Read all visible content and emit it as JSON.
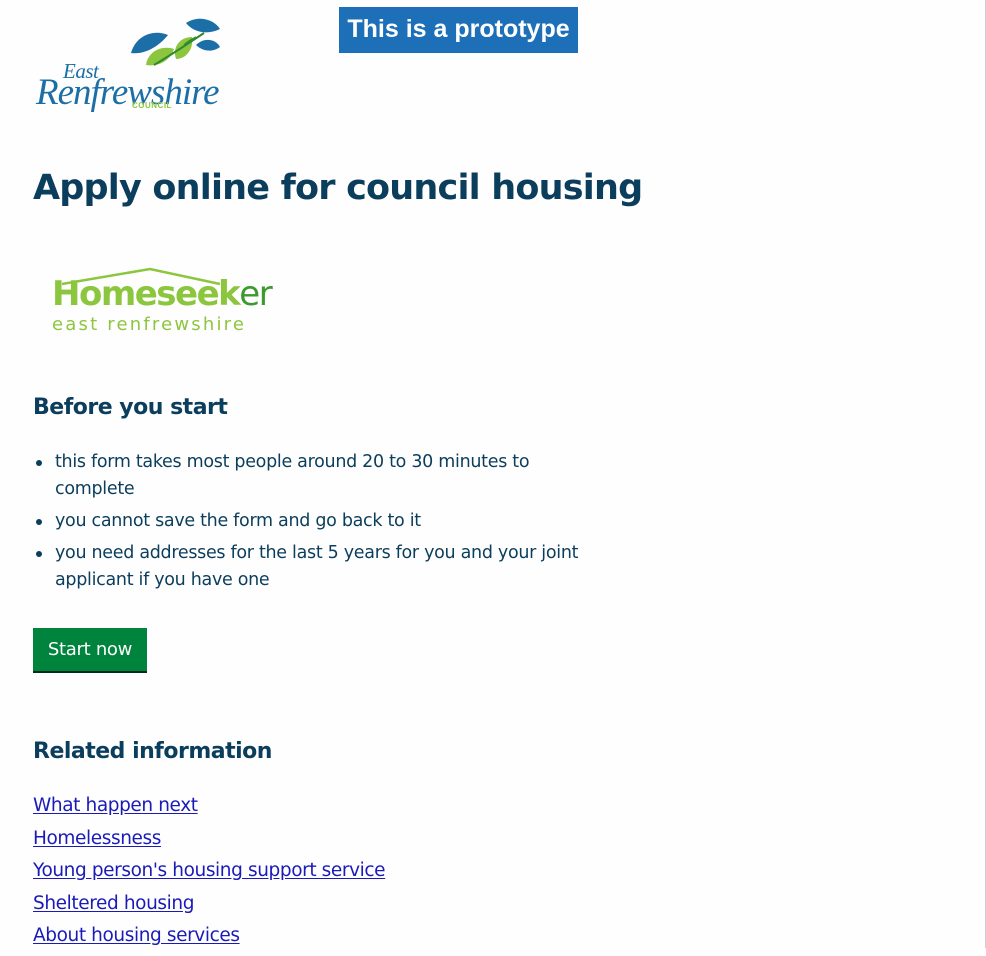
{
  "banner": {
    "text": "This is a prototype"
  },
  "council_logo": {
    "line1": "East",
    "line2": "Renfrewshire",
    "line3": "COUNCIL",
    "colors": {
      "text": "#1c6fa6",
      "leaf_green": "#8cc63f",
      "leaf_blue": "#1c6fa6"
    }
  },
  "page": {
    "title": "Apply online for council housing"
  },
  "homeseeker_logo": {
    "word_main": "Homeseek",
    "word_tail": "er",
    "subtitle": "east renfrewshire",
    "colors": {
      "light_green": "#8cc63f",
      "dark_green": "#3a9a2c"
    }
  },
  "before_you_start": {
    "heading": "Before you start",
    "items": [
      "this form takes most people around 20 to 30 minutes to complete",
      "you cannot save the form and go back to it",
      "you need addresses for the last 5 years for you and your joint applicant if you have one"
    ]
  },
  "start_button": {
    "label": "Start now",
    "color": "#00843d"
  },
  "related": {
    "heading": "Related information",
    "links": [
      "What happen next",
      "Homelessness",
      "Young person's housing support service",
      "Sheltered housing",
      "About housing services"
    ]
  },
  "colors": {
    "heading_text": "#0b3d5c",
    "banner_bg": "#1d70b8",
    "link": "#1a1ab8"
  }
}
